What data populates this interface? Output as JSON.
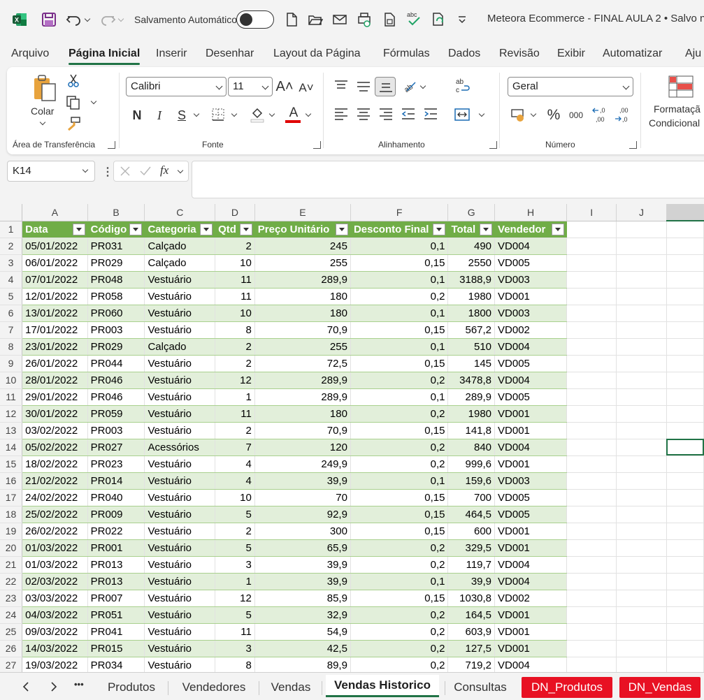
{
  "titlebar": {
    "autosave_label": "Salvamento Automático",
    "document_title": "Meteora Ecommerce - FINAL AULA 2 • Salvo n"
  },
  "menu": {
    "tabs": [
      "Arquivo",
      "Página Inicial",
      "Inserir",
      "Desenhar",
      "Layout da Página",
      "Fórmulas",
      "Dados",
      "Revisão",
      "Exibir",
      "Automatizar",
      "Aju"
    ],
    "active": "Página Inicial"
  },
  "ribbon": {
    "clipboard": {
      "paste_label": "Colar",
      "group_label": "Área de Transferência"
    },
    "font": {
      "family": "Calibri",
      "size": "11",
      "group_label": "Fonte"
    },
    "alignment": {
      "group_label": "Alinhamento"
    },
    "number": {
      "format": "Geral",
      "group_label": "Número"
    },
    "styles": {
      "conditional_line1": "Formataçã",
      "conditional_line2": "Condicional"
    }
  },
  "formula_bar": {
    "name_box": "K14",
    "fx": "fx",
    "value": ""
  },
  "sheet": {
    "column_letters": [
      "A",
      "B",
      "C",
      "D",
      "E",
      "F",
      "G",
      "H",
      "I",
      "J"
    ],
    "headers": [
      "Data",
      "Código",
      "Categoria",
      "Qtd",
      "Preço Unitário",
      "Desconto Final",
      "Total",
      "Vendedor"
    ],
    "rows": [
      [
        "05/01/2022",
        "PR031",
        "Calçado",
        "2",
        "245",
        "0,1",
        "490",
        "VD004"
      ],
      [
        "06/01/2022",
        "PR029",
        "Calçado",
        "10",
        "255",
        "0,15",
        "2550",
        "VD005"
      ],
      [
        "07/01/2022",
        "PR048",
        "Vestuário",
        "11",
        "289,9",
        "0,1",
        "3188,9",
        "VD003"
      ],
      [
        "12/01/2022",
        "PR058",
        "Vestuário",
        "11",
        "180",
        "0,2",
        "1980",
        "VD001"
      ],
      [
        "13/01/2022",
        "PR060",
        "Vestuário",
        "10",
        "180",
        "0,1",
        "1800",
        "VD003"
      ],
      [
        "17/01/2022",
        "PR003",
        "Vestuário",
        "8",
        "70,9",
        "0,15",
        "567,2",
        "VD002"
      ],
      [
        "23/01/2022",
        "PR029",
        "Calçado",
        "2",
        "255",
        "0,1",
        "510",
        "VD004"
      ],
      [
        "26/01/2022",
        "PR044",
        "Vestuário",
        "2",
        "72,5",
        "0,15",
        "145",
        "VD005"
      ],
      [
        "28/01/2022",
        "PR046",
        "Vestuário",
        "12",
        "289,9",
        "0,2",
        "3478,8",
        "VD004"
      ],
      [
        "29/01/2022",
        "PR046",
        "Vestuário",
        "1",
        "289,9",
        "0,1",
        "289,9",
        "VD005"
      ],
      [
        "30/01/2022",
        "PR059",
        "Vestuário",
        "11",
        "180",
        "0,2",
        "1980",
        "VD001"
      ],
      [
        "03/02/2022",
        "PR003",
        "Vestuário",
        "2",
        "70,9",
        "0,15",
        "141,8",
        "VD001"
      ],
      [
        "05/02/2022",
        "PR027",
        "Acessórios",
        "7",
        "120",
        "0,2",
        "840",
        "VD004"
      ],
      [
        "18/02/2022",
        "PR023",
        "Vestuário",
        "4",
        "249,9",
        "0,2",
        "999,6",
        "VD001"
      ],
      [
        "21/02/2022",
        "PR014",
        "Vestuário",
        "4",
        "39,9",
        "0,1",
        "159,6",
        "VD003"
      ],
      [
        "24/02/2022",
        "PR040",
        "Vestuário",
        "10",
        "70",
        "0,15",
        "700",
        "VD005"
      ],
      [
        "25/02/2022",
        "PR009",
        "Vestuário",
        "5",
        "92,9",
        "0,15",
        "464,5",
        "VD005"
      ],
      [
        "26/02/2022",
        "PR022",
        "Vestuário",
        "2",
        "300",
        "0,15",
        "600",
        "VD001"
      ],
      [
        "01/03/2022",
        "PR001",
        "Vestuário",
        "5",
        "65,9",
        "0,2",
        "329,5",
        "VD001"
      ],
      [
        "01/03/2022",
        "PR013",
        "Vestuário",
        "3",
        "39,9",
        "0,2",
        "119,7",
        "VD004"
      ],
      [
        "02/03/2022",
        "PR013",
        "Vestuário",
        "1",
        "39,9",
        "0,1",
        "39,9",
        "VD004"
      ],
      [
        "03/03/2022",
        "PR007",
        "Vestuário",
        "12",
        "85,9",
        "0,15",
        "1030,8",
        "VD002"
      ],
      [
        "04/03/2022",
        "PR051",
        "Vestuário",
        "5",
        "32,9",
        "0,2",
        "164,5",
        "VD001"
      ],
      [
        "09/03/2022",
        "PR041",
        "Vestuário",
        "11",
        "54,9",
        "0,2",
        "603,9",
        "VD001"
      ],
      [
        "14/03/2022",
        "PR015",
        "Vestuário",
        "3",
        "42,5",
        "0,2",
        "127,5",
        "VD001"
      ],
      [
        "19/03/2022",
        "PR034",
        "Vestuário",
        "8",
        "89,9",
        "0,2",
        "719,2",
        "VD004"
      ]
    ],
    "selected_cell": "K14",
    "header_color": "#70ad47",
    "band_color": "#e2efda"
  },
  "sheet_tabs": {
    "items": [
      "Produtos",
      "Vendedores",
      "Vendas",
      "Vendas Historico",
      "Consultas",
      "DN_Produtos",
      "DN_Vendas"
    ],
    "active": "Vendas Historico",
    "more": "•••"
  }
}
